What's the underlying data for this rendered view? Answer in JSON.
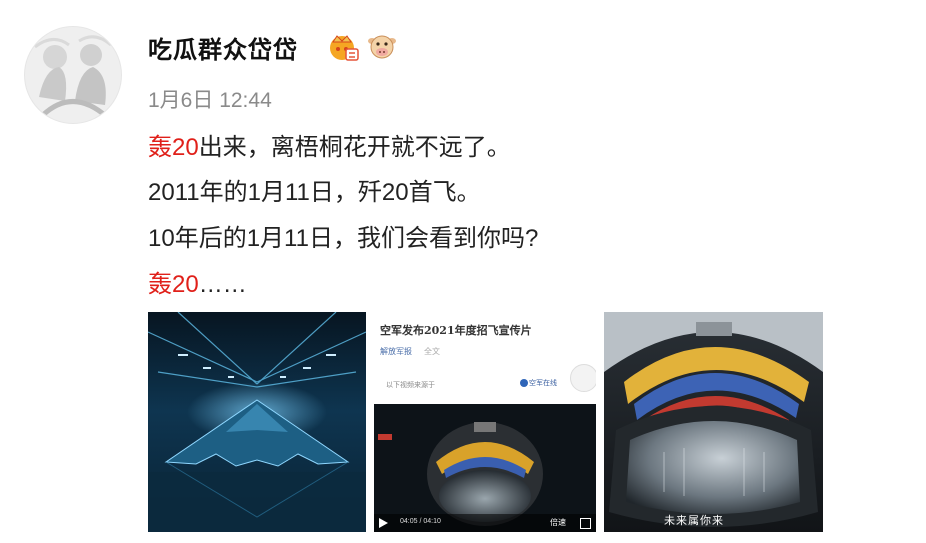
{
  "user": {
    "name": "吃瓜群众岱岱",
    "badges": [
      "crown-vip-icon",
      "cow-emoji-icon"
    ]
  },
  "post": {
    "time": "1月6日 12:44",
    "line1_highlight": "轰20",
    "line1_rest": "出来，离梧桐花开就不远了。",
    "line2": "2011年的1月11日，歼20首飞。",
    "line3": "10年后的1月11日，我们会看到你吗?",
    "line4_highlight": "轰20",
    "line4_rest": "……"
  },
  "images": {
    "second": {
      "title": "空军发布2021年度招飞宣传片",
      "source": "解放军报",
      "author": "全文",
      "note": "以下视频来源于",
      "brand": "空军在线",
      "time": "04:05 / 04:10",
      "speed": "倍速"
    },
    "third": {
      "caption": "未来属你来"
    }
  },
  "colors": {
    "highlight": "#e0201a",
    "timestamp": "#8a8a8a"
  }
}
